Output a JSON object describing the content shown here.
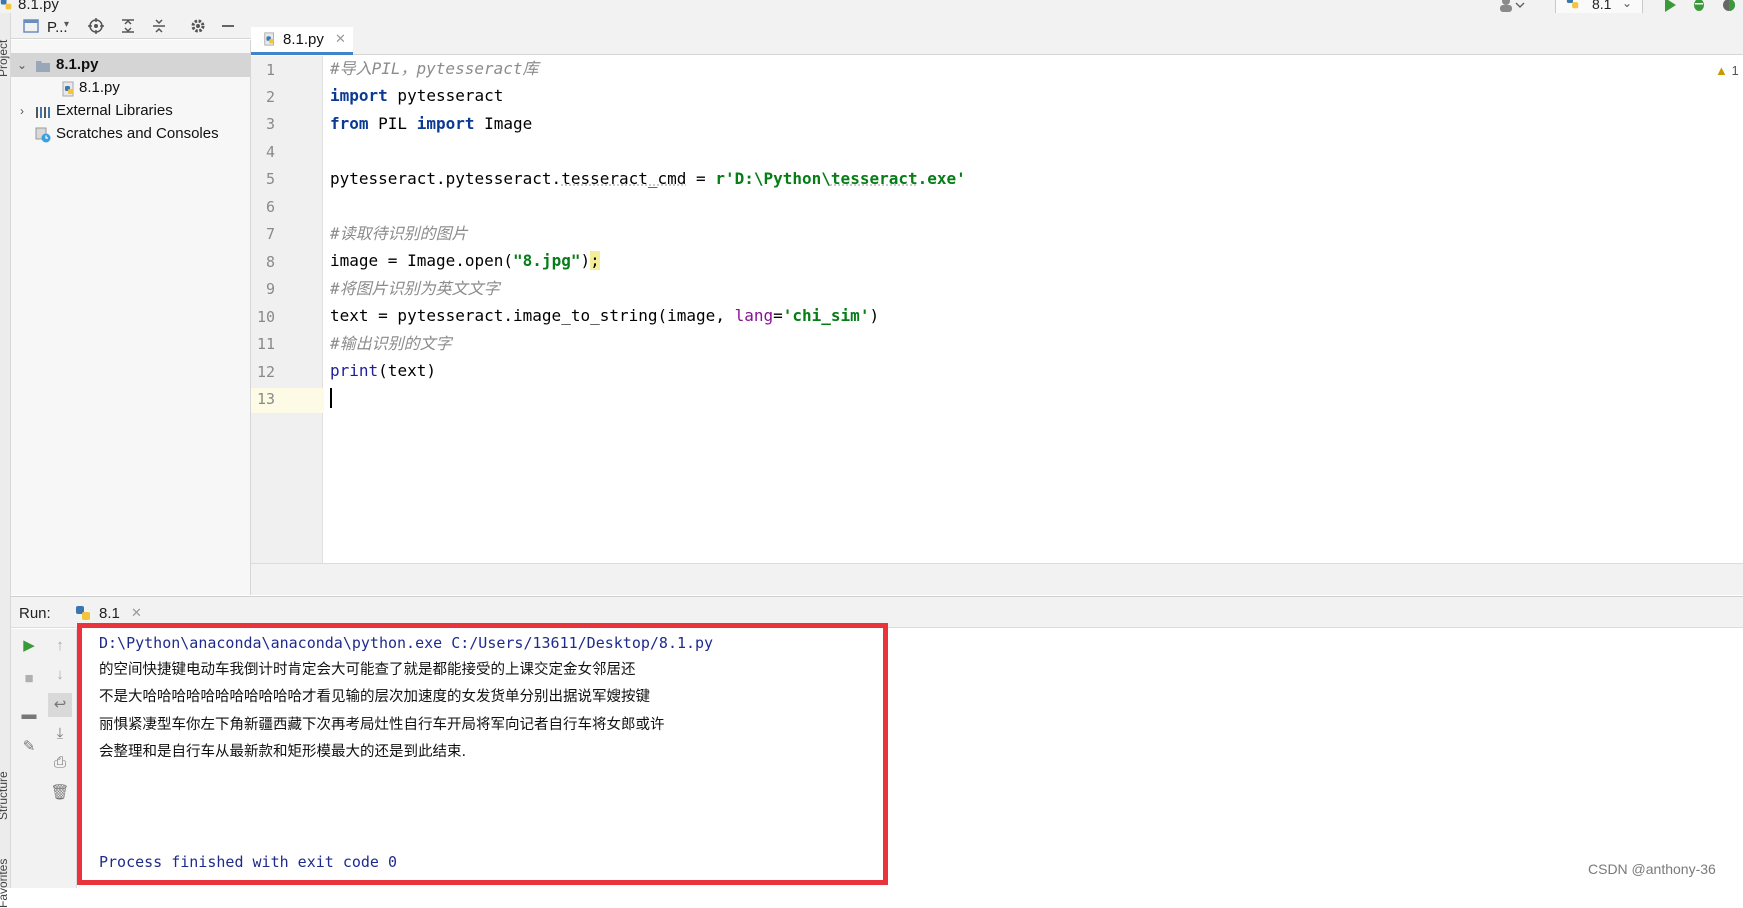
{
  "window": {
    "title": "8.1.py",
    "run_config": "8.1"
  },
  "left_strip": {
    "project_label": "Project",
    "structure_label": "Structure",
    "favorites_label": "Favorites"
  },
  "project_panel": {
    "view_selector": "P...",
    "tree": [
      {
        "label": "8.1.py",
        "selected": true,
        "expanded": true,
        "icon": "folder-icon"
      },
      {
        "label": "8.1.py",
        "selected": false,
        "icon": "python-file-icon"
      },
      {
        "label": "External Libraries",
        "selected": false,
        "expanded": false,
        "icon": "libraries-icon"
      },
      {
        "label": "Scratches and Consoles",
        "selected": false,
        "icon": "scratches-icon"
      }
    ]
  },
  "editor": {
    "tab_label": "8.1.py",
    "warning_count": "1",
    "line_numbers": [
      "1",
      "2",
      "3",
      "4",
      "5",
      "6",
      "7",
      "8",
      "9",
      "10",
      "11",
      "12",
      "13"
    ],
    "lines": {
      "l1_comment": "#导入PIL，pytesseract库",
      "l2_kw": "import",
      "l2_rest": " pytesseract",
      "l3_kw1": "from",
      "l3_mid": " PIL ",
      "l3_kw2": "import",
      "l3_rest": " Image",
      "l5_a": "pytesseract.pytesseract.",
      "l5_b": "tesseract_cmd",
      "l5_c": " = ",
      "l5_str_a": "r'D:\\Python\\",
      "l5_str_b": "tesseract",
      "l5_str_c": ".exe'",
      "l7_comment": "#读取待识别的图片",
      "l8_a": "image = Image.open(",
      "l8_str": "\"8.jpg\"",
      "l8_b": ")",
      "l8_semi": ";",
      "l9_comment": "#将图片识别为英文文字",
      "l10_a": "text = pytesseract.image_to_string(image, ",
      "l10_param": "lang",
      "l10_eq": "=",
      "l10_str": "'chi_sim'",
      "l10_b": ")",
      "l11_comment": "#输出识别的文字",
      "l12_builtin": "print",
      "l12_rest": "(text)"
    }
  },
  "run_panel": {
    "label": "Run:",
    "tab_label": "8.1",
    "output": {
      "command": "D:\\Python\\anaconda\\anaconda\\python.exe C:/Users/13611/Desktop/8.1.py",
      "text_lines": [
        "的空间快捷键电动车我倒计时肯定会大可能查了就是都能接受的上课交定金女邻居还",
        "不是大哈哈哈哈哈哈哈哈哈哈哈才看见输的层次加速度的女发货单分别出据说军嫂按键",
        "丽惧紧凄型车你左下角新疆西藏下次再考局灶性自行车开局将军向记者自行车将女郎或许",
        "会整理和是自行车从最新款和矩形模最大的还是到此结束."
      ],
      "exit_message": "Process finished with exit code 0"
    }
  },
  "watermark": "CSDN @anthony-36",
  "colors": {
    "keyword": "#0b3a93",
    "comment": "#8c8c8c",
    "string": "#067d17",
    "highlight_box": "#e8343a",
    "tab_underline": "#4083c9"
  }
}
